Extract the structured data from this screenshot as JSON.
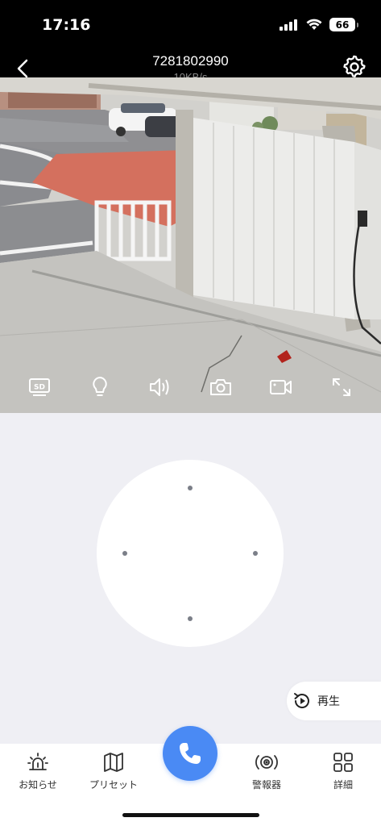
{
  "status_bar": {
    "time": "17:16",
    "battery": "66",
    "icons": [
      "signal-icon",
      "wifi-icon",
      "battery-icon"
    ]
  },
  "header": {
    "title": "7281802990",
    "speed": "10KB/s",
    "back_icon": "chevron-left-icon",
    "settings_icon": "gear-icon"
  },
  "video_controls": [
    {
      "name": "sd-quality-button",
      "icon": "sd-icon"
    },
    {
      "name": "light-button",
      "icon": "bulb-icon"
    },
    {
      "name": "audio-button",
      "icon": "speaker-icon"
    },
    {
      "name": "snapshot-button",
      "icon": "camera-icon"
    },
    {
      "name": "record-button",
      "icon": "video-camera-icon"
    },
    {
      "name": "fullscreen-button",
      "icon": "expand-icon"
    }
  ],
  "playback": {
    "label": "再生",
    "icon": "replay-icon"
  },
  "bottom_tabs": [
    {
      "label": "お知らせ",
      "icon": "alarm-light-icon"
    },
    {
      "label": "プリセット",
      "icon": "map-icon"
    },
    {
      "label": "",
      "icon": "phone-icon"
    },
    {
      "label": "警報器",
      "icon": "siren-icon"
    },
    {
      "label": "詳細",
      "icon": "grid-icon"
    }
  ],
  "colors": {
    "accent": "#4a8af4",
    "header_bg": "#000000",
    "page_bg": "#efeff4"
  }
}
